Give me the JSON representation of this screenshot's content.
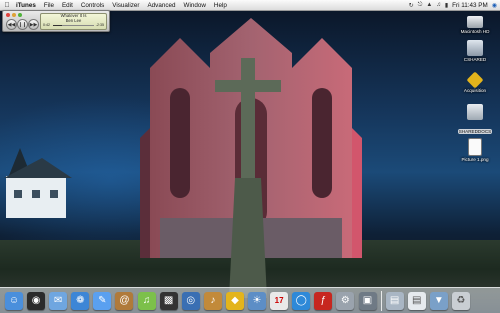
{
  "menubar": {
    "apple_icon": "apple-icon",
    "app_name": "iTunes",
    "menus": [
      "File",
      "Edit",
      "Controls",
      "Visualizer",
      "Advanced",
      "Window",
      "Help"
    ],
    "clock": "Fri 11:43 PM"
  },
  "mini_player": {
    "song": "Whatever It Is",
    "artist": "Ben Lee",
    "elapsed": "0:42",
    "remaining": "-2:35",
    "progress_fraction": 0.21
  },
  "desktop_icons": [
    {
      "label": "Macintosh HD",
      "icon": "hard-disk-icon",
      "selected": false
    },
    {
      "label": "CSHARED",
      "icon": "network-volume-icon",
      "selected": false
    },
    {
      "label": "Acquisition",
      "icon": "acquisition-app-icon",
      "selected": false
    },
    {
      "label": "SHAREDDOCS",
      "icon": "shared-drive-icon",
      "selected": true
    },
    {
      "label": "Picture 1.png",
      "icon": "png-file-icon",
      "selected": false
    }
  ],
  "dock": {
    "apps": [
      {
        "name": "Finder",
        "icon": "finder-icon",
        "color": "#4a8fdc"
      },
      {
        "name": "Dashboard",
        "icon": "dashboard-icon",
        "color": "#2b2b2b"
      },
      {
        "name": "Mail",
        "icon": "mail-icon",
        "color": "#6fa6e0"
      },
      {
        "name": "Safari",
        "icon": "safari-icon",
        "color": "#3d86d6"
      },
      {
        "name": "iChat",
        "icon": "ichat-icon",
        "color": "#5aa0f0"
      },
      {
        "name": "Address Book",
        "icon": "address-book-icon",
        "color": "#b07a3a"
      },
      {
        "name": "iTunes",
        "icon": "itunes-icon",
        "color": "#7cc04a"
      },
      {
        "name": "iMovie",
        "icon": "imovie-icon",
        "color": "#333333"
      },
      {
        "name": "iDVD",
        "icon": "idvd-icon",
        "color": "#3a6fb3"
      },
      {
        "name": "GarageBand",
        "icon": "garageband-icon",
        "color": "#c28a3a"
      },
      {
        "name": "Acquisition",
        "icon": "acquisition-icon",
        "color": "#e3b41c"
      },
      {
        "name": "iPhoto",
        "icon": "iphoto-icon",
        "color": "#5d8ec6"
      },
      {
        "name": "iCal",
        "icon": "ical-icon",
        "color": "#e9e9e9"
      },
      {
        "name": "Network",
        "icon": "network-icon",
        "color": "#2e89d8"
      },
      {
        "name": "Flash",
        "icon": "flash-icon",
        "color": "#c7271f"
      },
      {
        "name": "System Preferences",
        "icon": "system-preferences-icon",
        "color": "#9aa3ad"
      },
      {
        "name": "Stickies",
        "icon": "app-icon",
        "color": "#6f7a85"
      }
    ],
    "docs": [
      {
        "name": "Applications",
        "icon": "folder-icon",
        "color": "#a9b6c4"
      },
      {
        "name": "Documents",
        "icon": "document-icon",
        "color": "#e6eaee"
      },
      {
        "name": "Downloads",
        "icon": "downloads-icon",
        "color": "#7aa0c8"
      },
      {
        "name": "Trash",
        "icon": "trash-icon",
        "color": "#c9ced3"
      }
    ]
  }
}
